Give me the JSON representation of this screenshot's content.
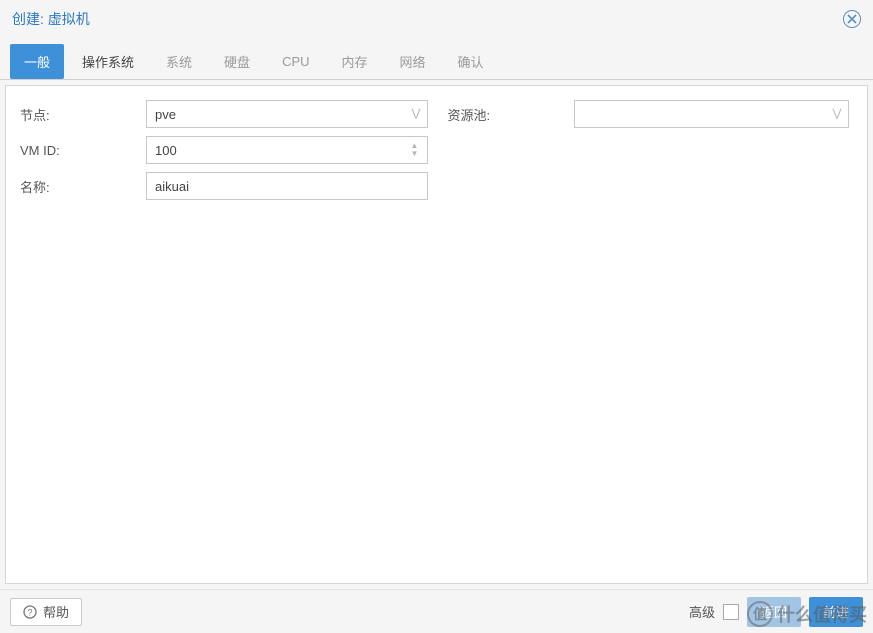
{
  "window": {
    "title": "创建: 虚拟机"
  },
  "tabs": [
    {
      "label": "一般",
      "state": "active"
    },
    {
      "label": "操作系统",
      "state": "enabled"
    },
    {
      "label": "系统",
      "state": "disabled"
    },
    {
      "label": "硬盘",
      "state": "disabled"
    },
    {
      "label": "CPU",
      "state": "disabled"
    },
    {
      "label": "内存",
      "state": "disabled"
    },
    {
      "label": "网络",
      "state": "disabled"
    },
    {
      "label": "确认",
      "state": "disabled"
    }
  ],
  "form": {
    "left": {
      "node": {
        "label": "节点:",
        "value": "pve"
      },
      "vmid": {
        "label": "VM ID:",
        "value": "100"
      },
      "name": {
        "label": "名称:",
        "value": "aikuai"
      }
    },
    "right": {
      "pool": {
        "label": "资源池:",
        "value": ""
      }
    }
  },
  "footer": {
    "help": "帮助",
    "advanced": "高级",
    "back": "返回",
    "next": "前进"
  },
  "watermark": {
    "prefix": "值",
    "text": "什么值得买"
  }
}
